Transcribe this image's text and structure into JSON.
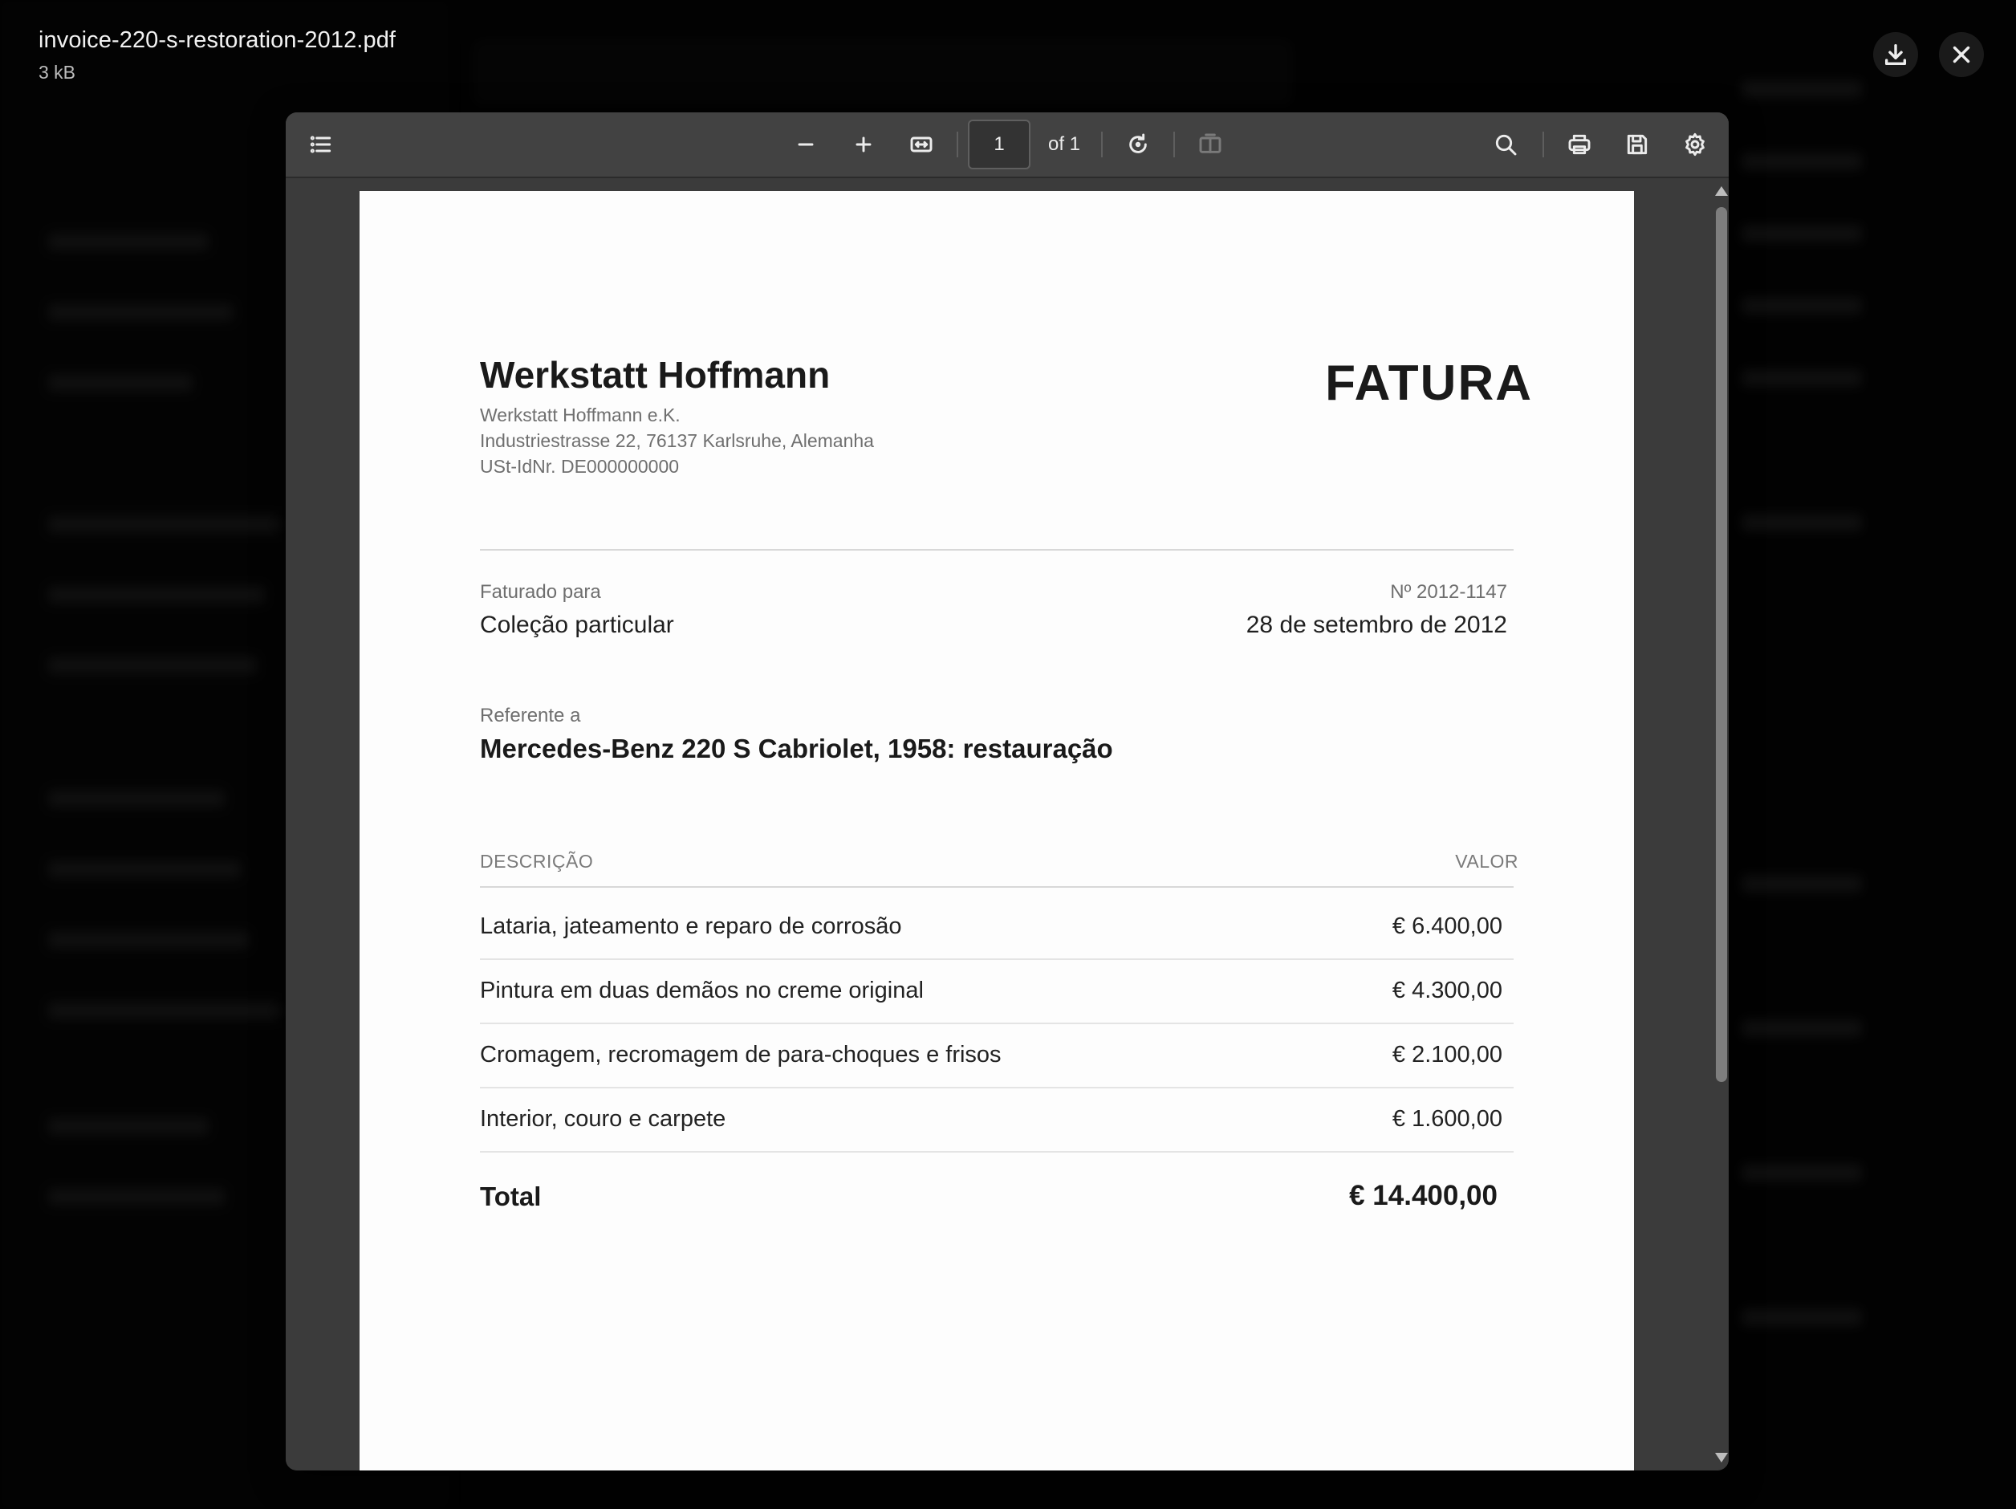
{
  "file": {
    "name": "invoice-220-s-restoration-2012.pdf",
    "size": "3 kB"
  },
  "top_actions": {
    "download_icon": "download-icon",
    "close_icon": "close-icon"
  },
  "toolbar": {
    "page_number": "1",
    "page_of": "of 1",
    "icons": [
      "sidebar-toggle-icon",
      "zoom-out-icon",
      "zoom-in-icon",
      "fit-width-icon",
      "rotate-icon",
      "two-page-icon",
      "search-icon",
      "print-icon",
      "save-icon",
      "settings-icon"
    ]
  },
  "invoice": {
    "company_name": "Werkstatt Hoffmann",
    "address_lines": [
      "Werkstatt Hoffmann e.K.",
      "Industriestrasse 22, 76137 Karlsruhe, Alemanha",
      "USt-IdNr. DE000000000"
    ],
    "title": "FATURA",
    "billed_to_label": "Faturado para",
    "billed_to": "Coleção particular",
    "number": "Nº 2012-1147",
    "date": "28 de setembro de 2012",
    "reference_label": "Referente a",
    "reference": "Mercedes-Benz 220 S Cabriolet, 1958: restauração",
    "col_description": "DESCRIÇÃO",
    "col_amount": "VALOR",
    "items": [
      {
        "description": "Lataria, jateamento e reparo de corrosão",
        "amount": "€ 6.400,00"
      },
      {
        "description": "Pintura em duas demãos no creme original",
        "amount": "€ 4.300,00"
      },
      {
        "description": "Cromagem, recromagem de para-choques e frisos",
        "amount": "€ 2.100,00"
      },
      {
        "description": "Interior, couro e carpete",
        "amount": "€ 1.600,00"
      }
    ],
    "total_label": "Total",
    "total_value": "€ 14.400,00"
  }
}
